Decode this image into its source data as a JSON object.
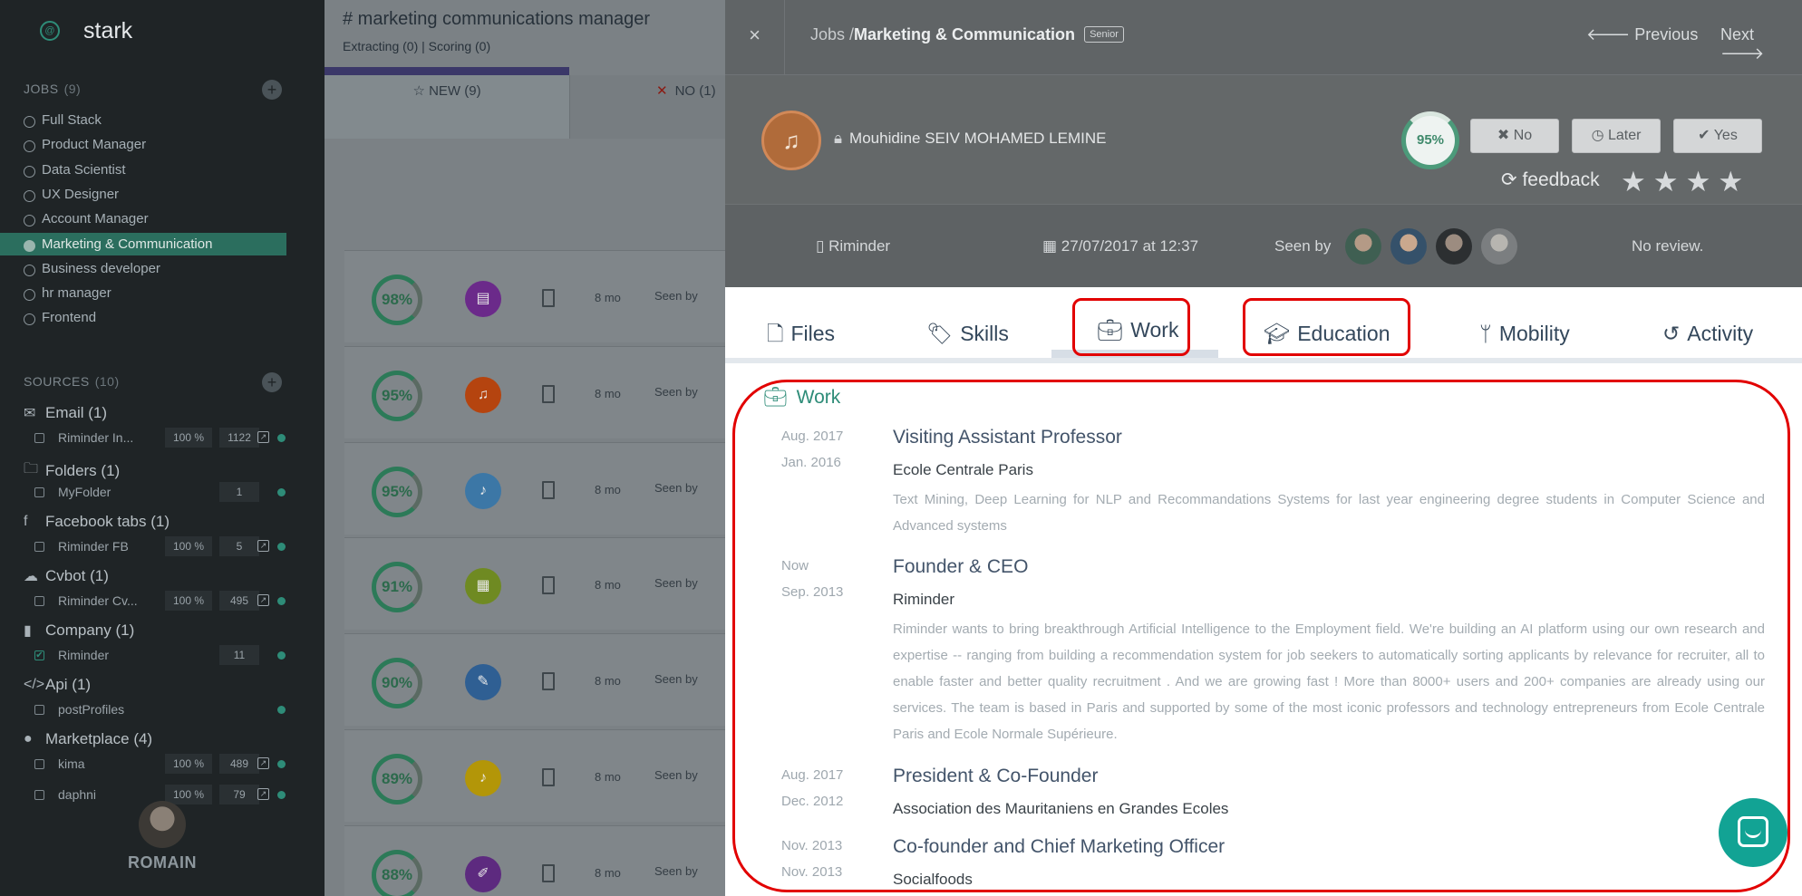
{
  "sidebar": {
    "brand": "stark",
    "jobs_title": "JOBS",
    "jobs_count": "(9)",
    "jobs": [
      "Full Stack",
      "Product Manager",
      "Data Scientist",
      "UX Designer",
      "Account Manager",
      "Marketing & Communication",
      "Business developer",
      "hr manager",
      "Frontend"
    ],
    "sources_title": "SOURCES",
    "sources_count": "(10)",
    "sources": [
      {
        "label": "Email (1)",
        "icon": "envelope-icon",
        "rows": [
          {
            "name": "Riminder In...",
            "pct": "100 %",
            "num": "1122",
            "checked": false
          }
        ]
      },
      {
        "label": "Folders (1)",
        "icon": "folder-icon",
        "rows": [
          {
            "name": "MyFolder",
            "pct": "",
            "num": "1",
            "checked": false
          }
        ]
      },
      {
        "label": "Facebook tabs (1)",
        "icon": "facebook-icon",
        "rows": [
          {
            "name": "Riminder FB",
            "pct": "100 %",
            "num": "5",
            "checked": false
          }
        ]
      },
      {
        "label": "Cvbot (1)",
        "icon": "cloud-upload-icon",
        "rows": [
          {
            "name": "Riminder Cv...",
            "pct": "100 %",
            "num": "495",
            "checked": false
          }
        ]
      },
      {
        "label": "Company (1)",
        "icon": "building-icon",
        "rows": [
          {
            "name": "Riminder",
            "pct": "",
            "num": "11",
            "checked": true
          }
        ]
      },
      {
        "label": "Api (1)",
        "icon": "code-icon",
        "rows": [
          {
            "name": "postProfiles",
            "pct": "",
            "num": "",
            "checked": false
          }
        ]
      },
      {
        "label": "Marketplace (4)",
        "icon": "globe-icon",
        "rows": [
          {
            "name": "kima",
            "pct": "100 %",
            "num": "489",
            "checked": false
          },
          {
            "name": "daphni",
            "pct": "100 %",
            "num": "79",
            "checked": false
          }
        ]
      }
    ],
    "user_name": "ROMAIN"
  },
  "middle": {
    "title": "# marketing communications manager",
    "subtitle": "Extracting (0)  |  Scoring (0)",
    "tab_new": "NEW (9)",
    "tab_no": "NO (1)",
    "candidates": [
      {
        "score": "98%",
        "color": "#6b2a8a",
        "glyph": "▤",
        "age": "8 mo",
        "seen": "Seen by"
      },
      {
        "score": "95%",
        "color": "#b5440f",
        "glyph": "♫",
        "age": "8 mo",
        "seen": "Seen by"
      },
      {
        "score": "95%",
        "color": "#3c77a6",
        "glyph": "♪",
        "age": "8 mo",
        "seen": "Seen by"
      },
      {
        "score": "91%",
        "color": "#6f8a22",
        "glyph": "▦",
        "age": "8 mo",
        "seen": "Seen by"
      },
      {
        "score": "90%",
        "color": "#2f5f93",
        "glyph": "✎",
        "age": "8 mo",
        "seen": "Seen by"
      },
      {
        "score": "89%",
        "color": "#b39608",
        "glyph": "♪",
        "age": "8 mo",
        "seen": "Seen by"
      },
      {
        "score": "88%",
        "color": "#5d2a7f",
        "glyph": "✐",
        "age": "8 mo",
        "seen": "Seen by"
      }
    ]
  },
  "detail": {
    "close": "×",
    "crumb_path": "Jobs /",
    "crumb_job": "Marketing & Communication",
    "badge": "Senior",
    "prev": "Previous",
    "next": "Next",
    "profile_name": "Mouhidine SEIV MOHAMED LEMINE",
    "score": "95%",
    "btn_no": "No",
    "btn_later": "Later",
    "btn_yes": "Yes",
    "feedback": "feedback",
    "source": "Riminder",
    "date": "27/07/2017 at 12:37",
    "seen_by": "Seen by",
    "review": "No review.",
    "tabs": {
      "files": "Files",
      "skills": "Skills",
      "work": "Work",
      "education": "Education",
      "mobility": "Mobility",
      "activity": "Activity"
    },
    "work_heading": "Work",
    "experiences": [
      {
        "end": "Aug. 2017",
        "start": "Jan. 2016",
        "title": "Visiting Assistant Professor",
        "company": "Ecole Centrale Paris",
        "description": "Text Mining, Deep Learning for NLP and Recommandations Systems for last year engineering degree students in Computer Science and Advanced systems"
      },
      {
        "end": "Now",
        "start": "Sep. 2013",
        "title": "Founder & CEO",
        "company": "Riminder",
        "description": "Riminder wants to bring breakthrough Artificial Intelligence to the Employment field. We're building an AI platform using our own research and expertise -- ranging from building a recommendation system for job seekers to automatically sorting applicants by relevance for recruiter, all to enable faster and better quality recruitment . And we are growing fast ! More than 8000+ users and 200+ companies are already using our services. The team is based in Paris and supported by some of the most iconic professors and technology entrepreneurs from Ecole Centrale Paris and Ecole Normale Supérieure."
      },
      {
        "end": "Aug. 2017",
        "start": "Dec. 2012",
        "title": "President & Co-Founder",
        "company": "Association des Mauritaniens en Grandes Ecoles",
        "description": ""
      },
      {
        "end": "Nov. 2013",
        "start": "Nov. 2013",
        "title": "Co-founder and Chief Marketing Officer",
        "company": "Socialfoods",
        "description": ""
      }
    ]
  },
  "colors": {
    "accent": "#2e8c78",
    "highlight": "#e20000",
    "sidebar_bg": "#1f2426",
    "active_job": "#2b6e5e"
  }
}
